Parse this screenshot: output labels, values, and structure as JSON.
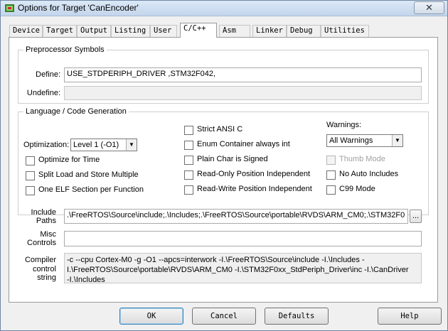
{
  "window": {
    "title": "Options for Target 'CanEncoder'",
    "close_glyph": "✕"
  },
  "tabs": [
    "Device",
    "Target",
    "Output",
    "Listing",
    "User",
    "C/C++",
    "Asm",
    "Linker",
    "Debug",
    "Utilities"
  ],
  "active_tab": "C/C++",
  "preprocessor": {
    "legend": "Preprocessor Symbols",
    "define_label": "Define:",
    "define_value": "USE_STDPERIPH_DRIVER ,STM32F042,",
    "undefine_label": "Undefine:",
    "undefine_value": ""
  },
  "language": {
    "legend": "Language / Code Generation",
    "optimization_label": "Optimization:",
    "optimization_value": "Level 1 (-O1)",
    "options": [
      {
        "label": "Optimize for Time",
        "checked": false
      },
      {
        "label": "Split Load and Store Multiple",
        "checked": false
      },
      {
        "label": "One ELF Section per Function",
        "checked": false
      },
      {
        "label": "Strict ANSI C",
        "checked": false
      },
      {
        "label": "Enum Container always int",
        "checked": false
      },
      {
        "label": "Plain Char is Signed",
        "checked": false
      },
      {
        "label": "Read-Only Position Independent",
        "checked": false
      },
      {
        "label": "Read-Write Position Independent",
        "checked": false
      },
      {
        "label": "Thumb Mode",
        "checked": false,
        "disabled": true
      },
      {
        "label": "No Auto Includes",
        "checked": false
      },
      {
        "label": "C99 Mode",
        "checked": false
      }
    ],
    "warnings_label": "Warnings:",
    "warnings_value": "All Warnings"
  },
  "include_paths": {
    "label_line1": "Include",
    "label_line2": "Paths",
    "value": ".\\FreeRTOS\\Source\\include;.\\Includes;.\\FreeRTOS\\Source\\portable\\RVDS\\ARM_CM0;.\\STM32F0",
    "browse_label": "..."
  },
  "misc_controls": {
    "label_line1": "Misc",
    "label_line2": "Controls",
    "value": ""
  },
  "compiler_control": {
    "label_line1": "Compiler",
    "label_line2": "control",
    "label_line3": "string",
    "value": "-c --cpu Cortex-M0 -g -O1 --apcs=interwork -I.\\FreeRTOS\\Source\\include -I.\\Includes -I.\\FreeRTOS\\Source\\portable\\RVDS\\ARM_CM0 -I.\\STM32F0xx_StdPeriph_Driver\\inc -I.\\CanDriver -I.\\Includes"
  },
  "buttons": {
    "ok": "OK",
    "cancel": "Cancel",
    "defaults": "Defaults",
    "help": "Help"
  },
  "combo_arrow": "▼"
}
